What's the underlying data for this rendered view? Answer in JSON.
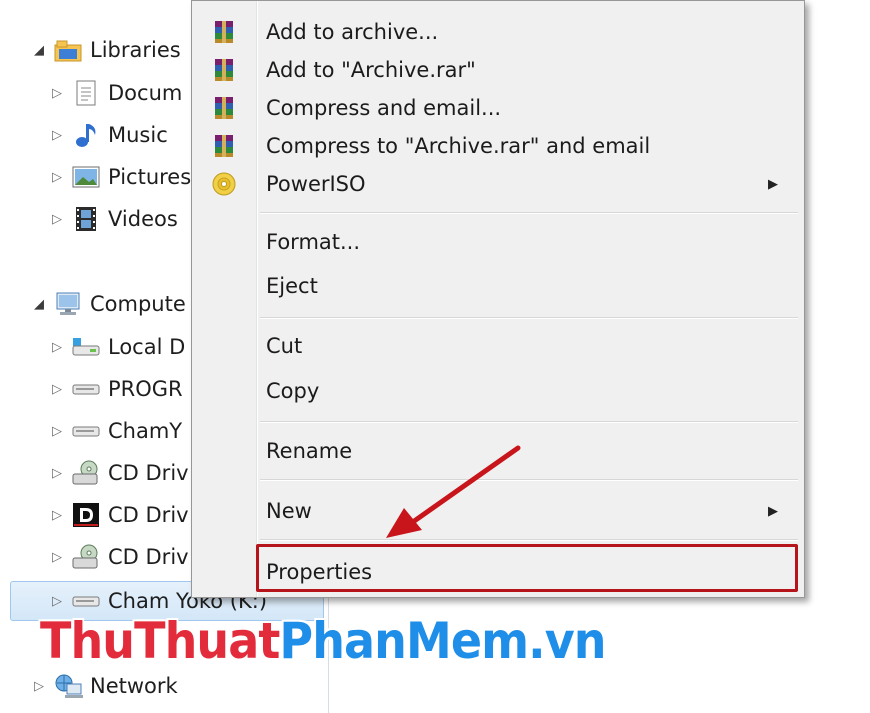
{
  "nav": {
    "items": [
      {
        "label": "Libraries",
        "icon": "libraries-icon",
        "arrow": "◢"
      },
      {
        "label": "Docum",
        "icon": "documents-icon",
        "arrow": "▷"
      },
      {
        "label": "Music",
        "icon": "music-icon",
        "arrow": "▷"
      },
      {
        "label": "Pictures",
        "icon": "pictures-icon",
        "arrow": "▷"
      },
      {
        "label": "Videos",
        "icon": "videos-icon",
        "arrow": "▷"
      },
      {
        "label": "Compute",
        "icon": "computer-icon",
        "arrow": "◢"
      },
      {
        "label": "Local D",
        "icon": "local-disk-icon",
        "arrow": "▷"
      },
      {
        "label": "PROGR",
        "icon": "drive-icon",
        "arrow": "▷"
      },
      {
        "label": "ChamY",
        "icon": "drive-icon",
        "arrow": "▷"
      },
      {
        "label": "CD Driv",
        "icon": "cd-drive-icon",
        "arrow": "▷"
      },
      {
        "label": "CD Driv",
        "icon": "daemon-drive-icon",
        "arrow": "▷"
      },
      {
        "label": "CD Driv",
        "icon": "cd-drive-icon",
        "arrow": "▷"
      },
      {
        "label": "Cham Yoko (K:)",
        "icon": "drive-icon",
        "arrow": "▷"
      },
      {
        "label": "Network",
        "icon": "network-icon",
        "arrow": "▷"
      }
    ]
  },
  "menu": {
    "add_to_archive": "Add to archive...",
    "add_to_rar": "Add to \"Archive.rar\"",
    "compress_email": "Compress and email...",
    "compress_rar_email": "Compress to \"Archive.rar\" and email",
    "poweriso": "PowerISO",
    "format": "Format...",
    "eject": "Eject",
    "cut": "Cut",
    "copy": "Copy",
    "rename": "Rename",
    "new": "New",
    "properties": "Properties",
    "submenu_arrow": "▶"
  },
  "watermark": {
    "part1": "ThuThuat",
    "part2": "PhanMem.vn"
  },
  "colors": {
    "highlight_red": "#b5141a",
    "watermark_red": "#e32c3b",
    "watermark_blue": "#1e8ee8"
  }
}
